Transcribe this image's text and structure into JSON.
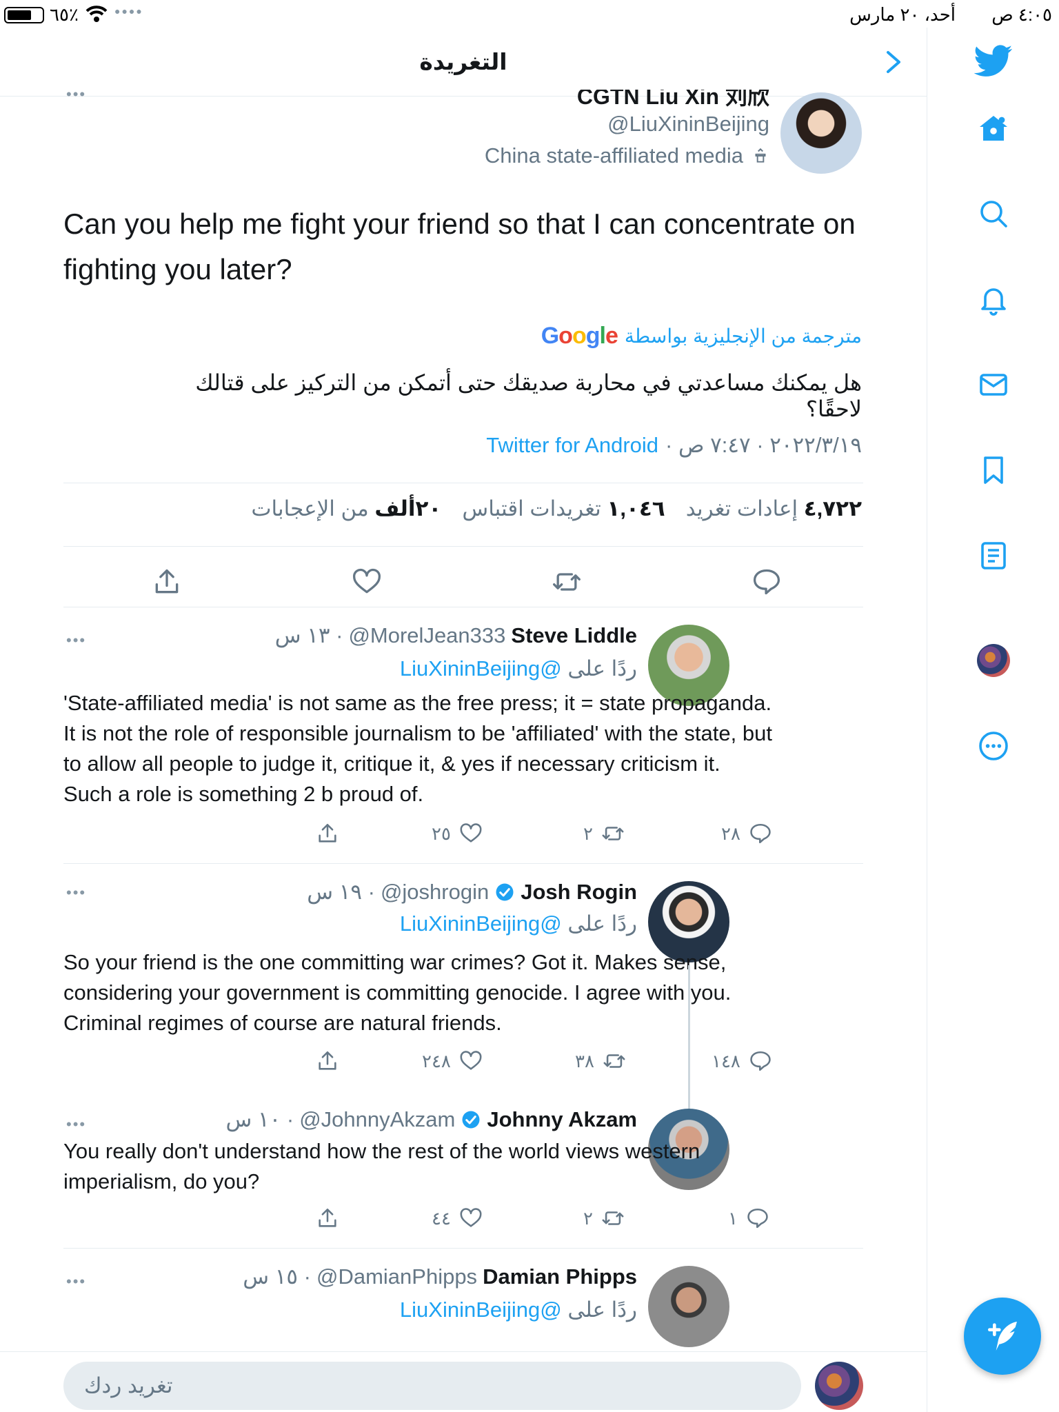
{
  "status_bar": {
    "time": "٤:٠٥ ص",
    "date": "أحد، ٢٠ مارس",
    "battery_percent": "٦٥٪",
    "battery_level": 0.65
  },
  "header": {
    "title": "التغريدة"
  },
  "main_tweet": {
    "author_name": "CGTN Liu Xin 刘欣",
    "author_handle": "@LiuXininBeijing",
    "author_label": "China state-affiliated media",
    "text": "Can you help me fight your friend so that I can concentrate on fighting you later?",
    "translated_by": "مترجمة من الإنجليزية بواسطة",
    "google_logo": "Google",
    "translated_text": "هل يمكنك مساعدتي في محاربة صديقك حتى أتمكن من التركيز على قتالك لاحقًا؟",
    "date": "٢٠٢٢/٣/١٩ · ٧:٤٧ ص ·",
    "source": "Twitter for Android",
    "stats": {
      "retweets_count": "٤,٧٢٢",
      "retweets_label": "إعادات تغريد",
      "quotes_count": "١,٠٤٦",
      "quotes_label": "تغريدات اقتباس",
      "likes_count": "٢٠ألف",
      "likes_label": "من الإعجابات"
    }
  },
  "replies": [
    {
      "name": "Steve Liddle",
      "handle": "@MorelJean333",
      "time": "· ١٣ س",
      "verified": false,
      "replying_to_prefix": "ردًا على",
      "replying_to": "@LiuXininBeijing",
      "text": "'State-affiliated media' is not same as the free press; it = state propaganda. It is not the role of responsible journalism to be 'affiliated' with the state, but to allow all people to judge it, critique it, & yes if necessary criticism it. Such a role is something 2 b proud of.",
      "reply_count": "٢٨",
      "retweet_count": "٢",
      "like_count": "٢٥"
    },
    {
      "name": "Josh Rogin",
      "handle": "@joshrogin",
      "time": "· ١٩ س",
      "verified": true,
      "replying_to_prefix": "ردًا على",
      "replying_to": "@LiuXininBeijing",
      "text": "So your friend is the one committing war crimes? Got it. Makes sense, considering your government is committing genocide. I agree with you. Criminal regimes of course are natural friends.",
      "reply_count": "١٤٨",
      "retweet_count": "٣٨",
      "like_count": "٢٤٨"
    },
    {
      "name": "Johnny Akzam",
      "handle": "@JohnnyAkzam",
      "time": "· ١٠ س",
      "verified": true,
      "text": "You really don't understand how the rest of the world views western imperialism, do you?",
      "reply_count": "١",
      "retweet_count": "٢",
      "like_count": "٤٤"
    },
    {
      "name": "Damian Phipps",
      "handle": "@DamianPhipps",
      "time": "· ١٥ س",
      "verified": false,
      "replying_to_prefix": "ردًا على",
      "replying_to": "@LiuXininBeijing"
    }
  ],
  "composer": {
    "placeholder": "تغريد ردك"
  },
  "colors": {
    "accent": "#1da1f2",
    "text": "#14171a",
    "secondary": "#657786",
    "divider": "#e6ecf0"
  },
  "icons": {
    "rail": [
      "twitter-bird-icon",
      "home-icon",
      "search-icon",
      "bell-icon",
      "mail-icon",
      "bookmark-icon",
      "lists-icon",
      "profile-avatar",
      "more-icon"
    ],
    "actions": [
      "reply-icon",
      "retweet-icon",
      "like-icon",
      "share-icon"
    ]
  }
}
